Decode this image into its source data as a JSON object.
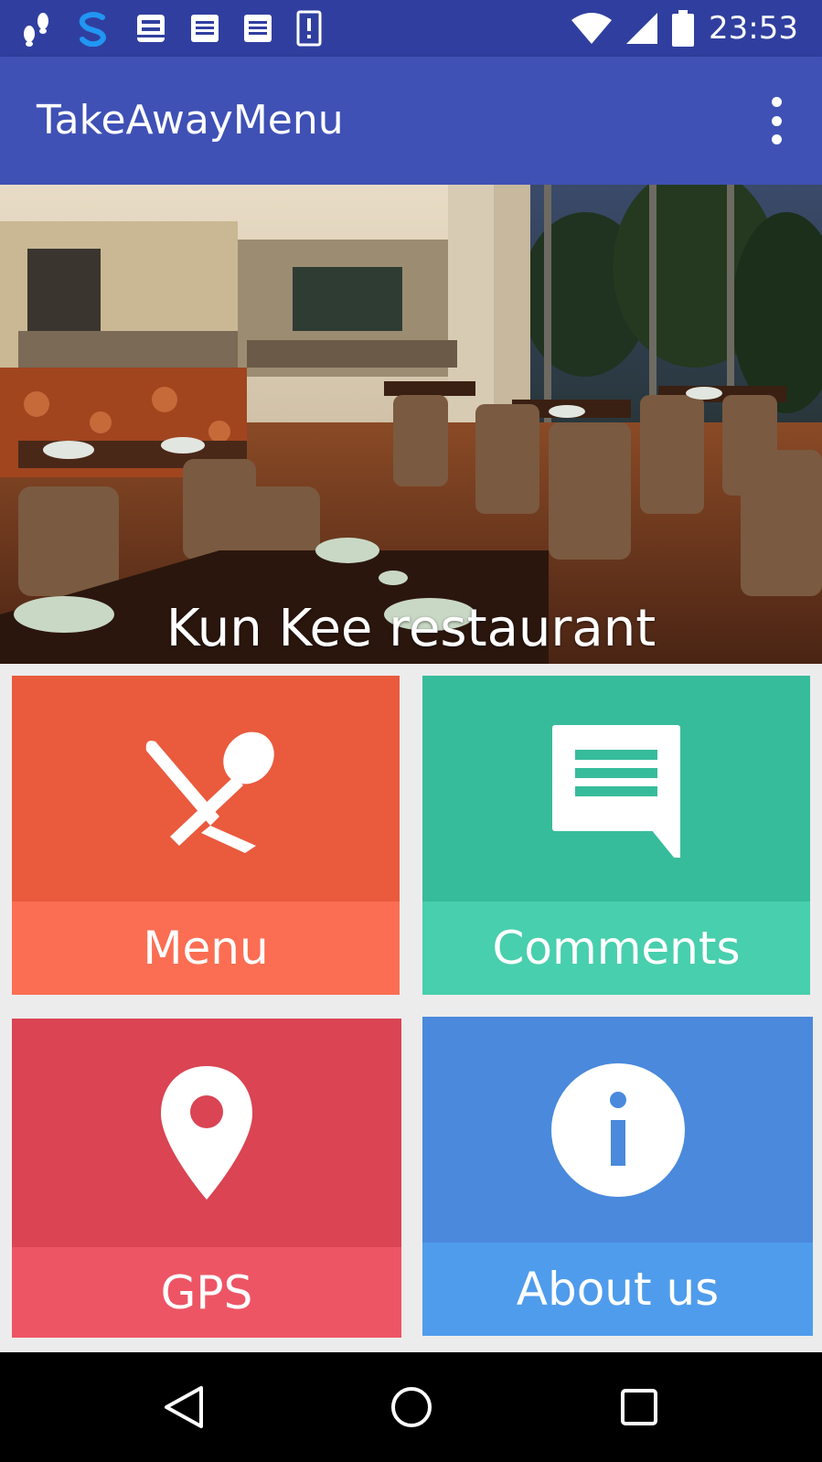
{
  "status_bar": {
    "time": "23:53",
    "left_icons": [
      "footsteps-icon",
      "s-app-icon",
      "inbox-icon",
      "notes-icon",
      "notes-icon",
      "alert-card-icon"
    ],
    "right_icons": [
      "wifi-icon",
      "signal-icon",
      "battery-icon"
    ]
  },
  "app_bar": {
    "title": "TakeAwayMenu",
    "overflow_icon": "more-vert-icon"
  },
  "hero": {
    "caption": "Kun Kee restaurant"
  },
  "tiles": [
    {
      "label": "Menu",
      "icon": "cutlery-icon",
      "color_top": "#ea5a3d",
      "color_bottom": "#fb6e53"
    },
    {
      "label": "Comments",
      "icon": "comment-icon",
      "color_top": "#37bc9b",
      "color_bottom": "#48cfad"
    },
    {
      "label": "GPS",
      "icon": "location-pin-icon",
      "color_top": "#da4453",
      "color_bottom": "#ed5565"
    },
    {
      "label": "About us",
      "icon": "info-icon",
      "color_top": "#4a89dc",
      "color_bottom": "#4f9cec"
    }
  ],
  "nav_bar": {
    "back_icon": "back-icon",
    "home_icon": "home-icon",
    "recents_icon": "recents-icon"
  }
}
